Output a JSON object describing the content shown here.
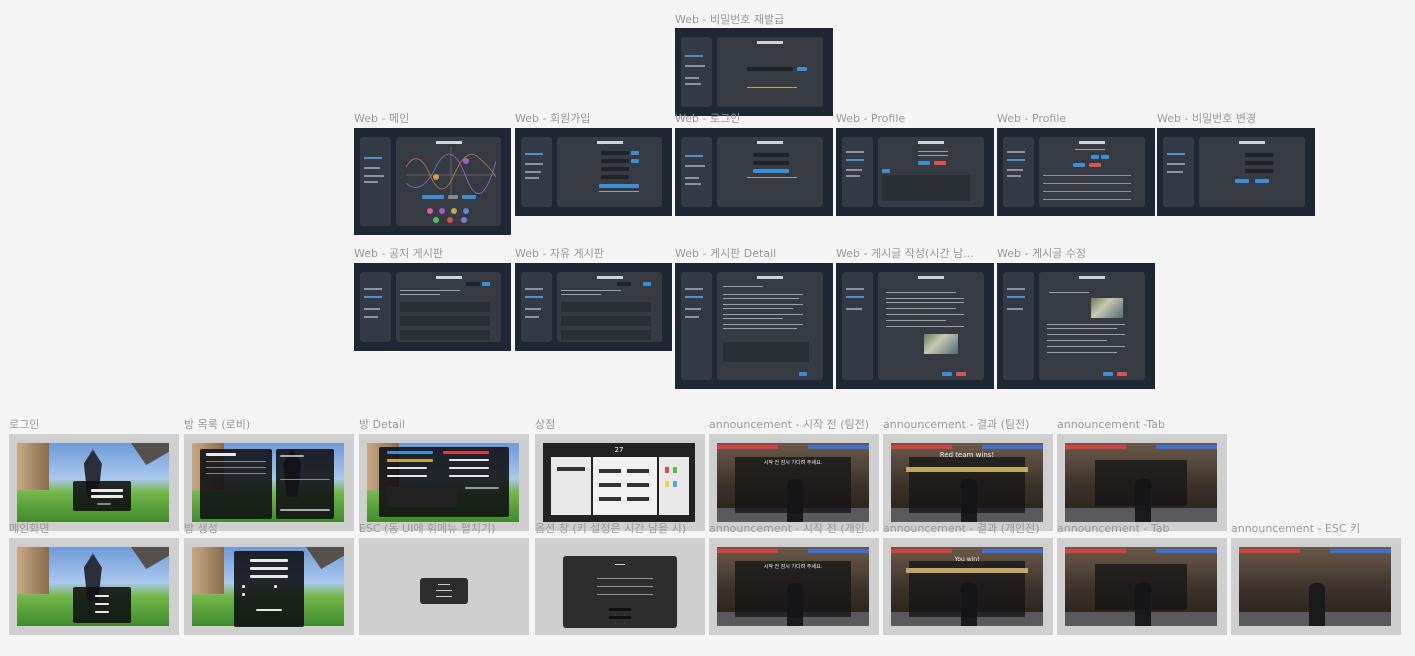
{
  "frames": {
    "web_pw_reissue": "Web - 비밀번호 재발급",
    "web_main": "Web - 메인",
    "web_signup": "Web - 회원가입",
    "web_login": "Web - 로그인",
    "web_profile_1": "Web - Profile",
    "web_profile_2": "Web - Profile",
    "web_pw_change": "Web - 비밀번호 변경",
    "web_notice_board": "Web - 공지 게시판",
    "web_free_board": "Web - 자유 게시판",
    "web_board_detail": "Web - 게시판 Detail",
    "web_post_write": "Web - 게시글 작성(시간 남...",
    "web_post_edit": "Web - 게시글 수정",
    "game_login": "로그인",
    "game_room_list": "방 목록 (로비)",
    "game_room_detail": "방 Detail",
    "game_shop": "상점",
    "ann_before_team": "announcement - 시작 전 (팀전)",
    "ann_result_team": "announcement - 결과 (팀전)",
    "ann_tab": "announcement -Tab",
    "game_main": "메인화면",
    "game_room_create": "방 생성",
    "game_esc": "ESC (동 UI에 휘메뉴 펼치기)",
    "game_settings": "옵션 창 (키 설정은 시간 남을 시)",
    "ann_before_solo": "announcement - 시작 전 (개인전)",
    "ann_result_solo": "announcement - 결과 (개인전)",
    "ann_tab_2": "announcement - Tab",
    "ann_esc": "announcement - ESC 키"
  },
  "texts": {
    "team_win": "Red team wins!",
    "solo_win": "You win!",
    "start_msg": "시작 전 잠시 기다려 주세요.",
    "shop_count": "27"
  }
}
